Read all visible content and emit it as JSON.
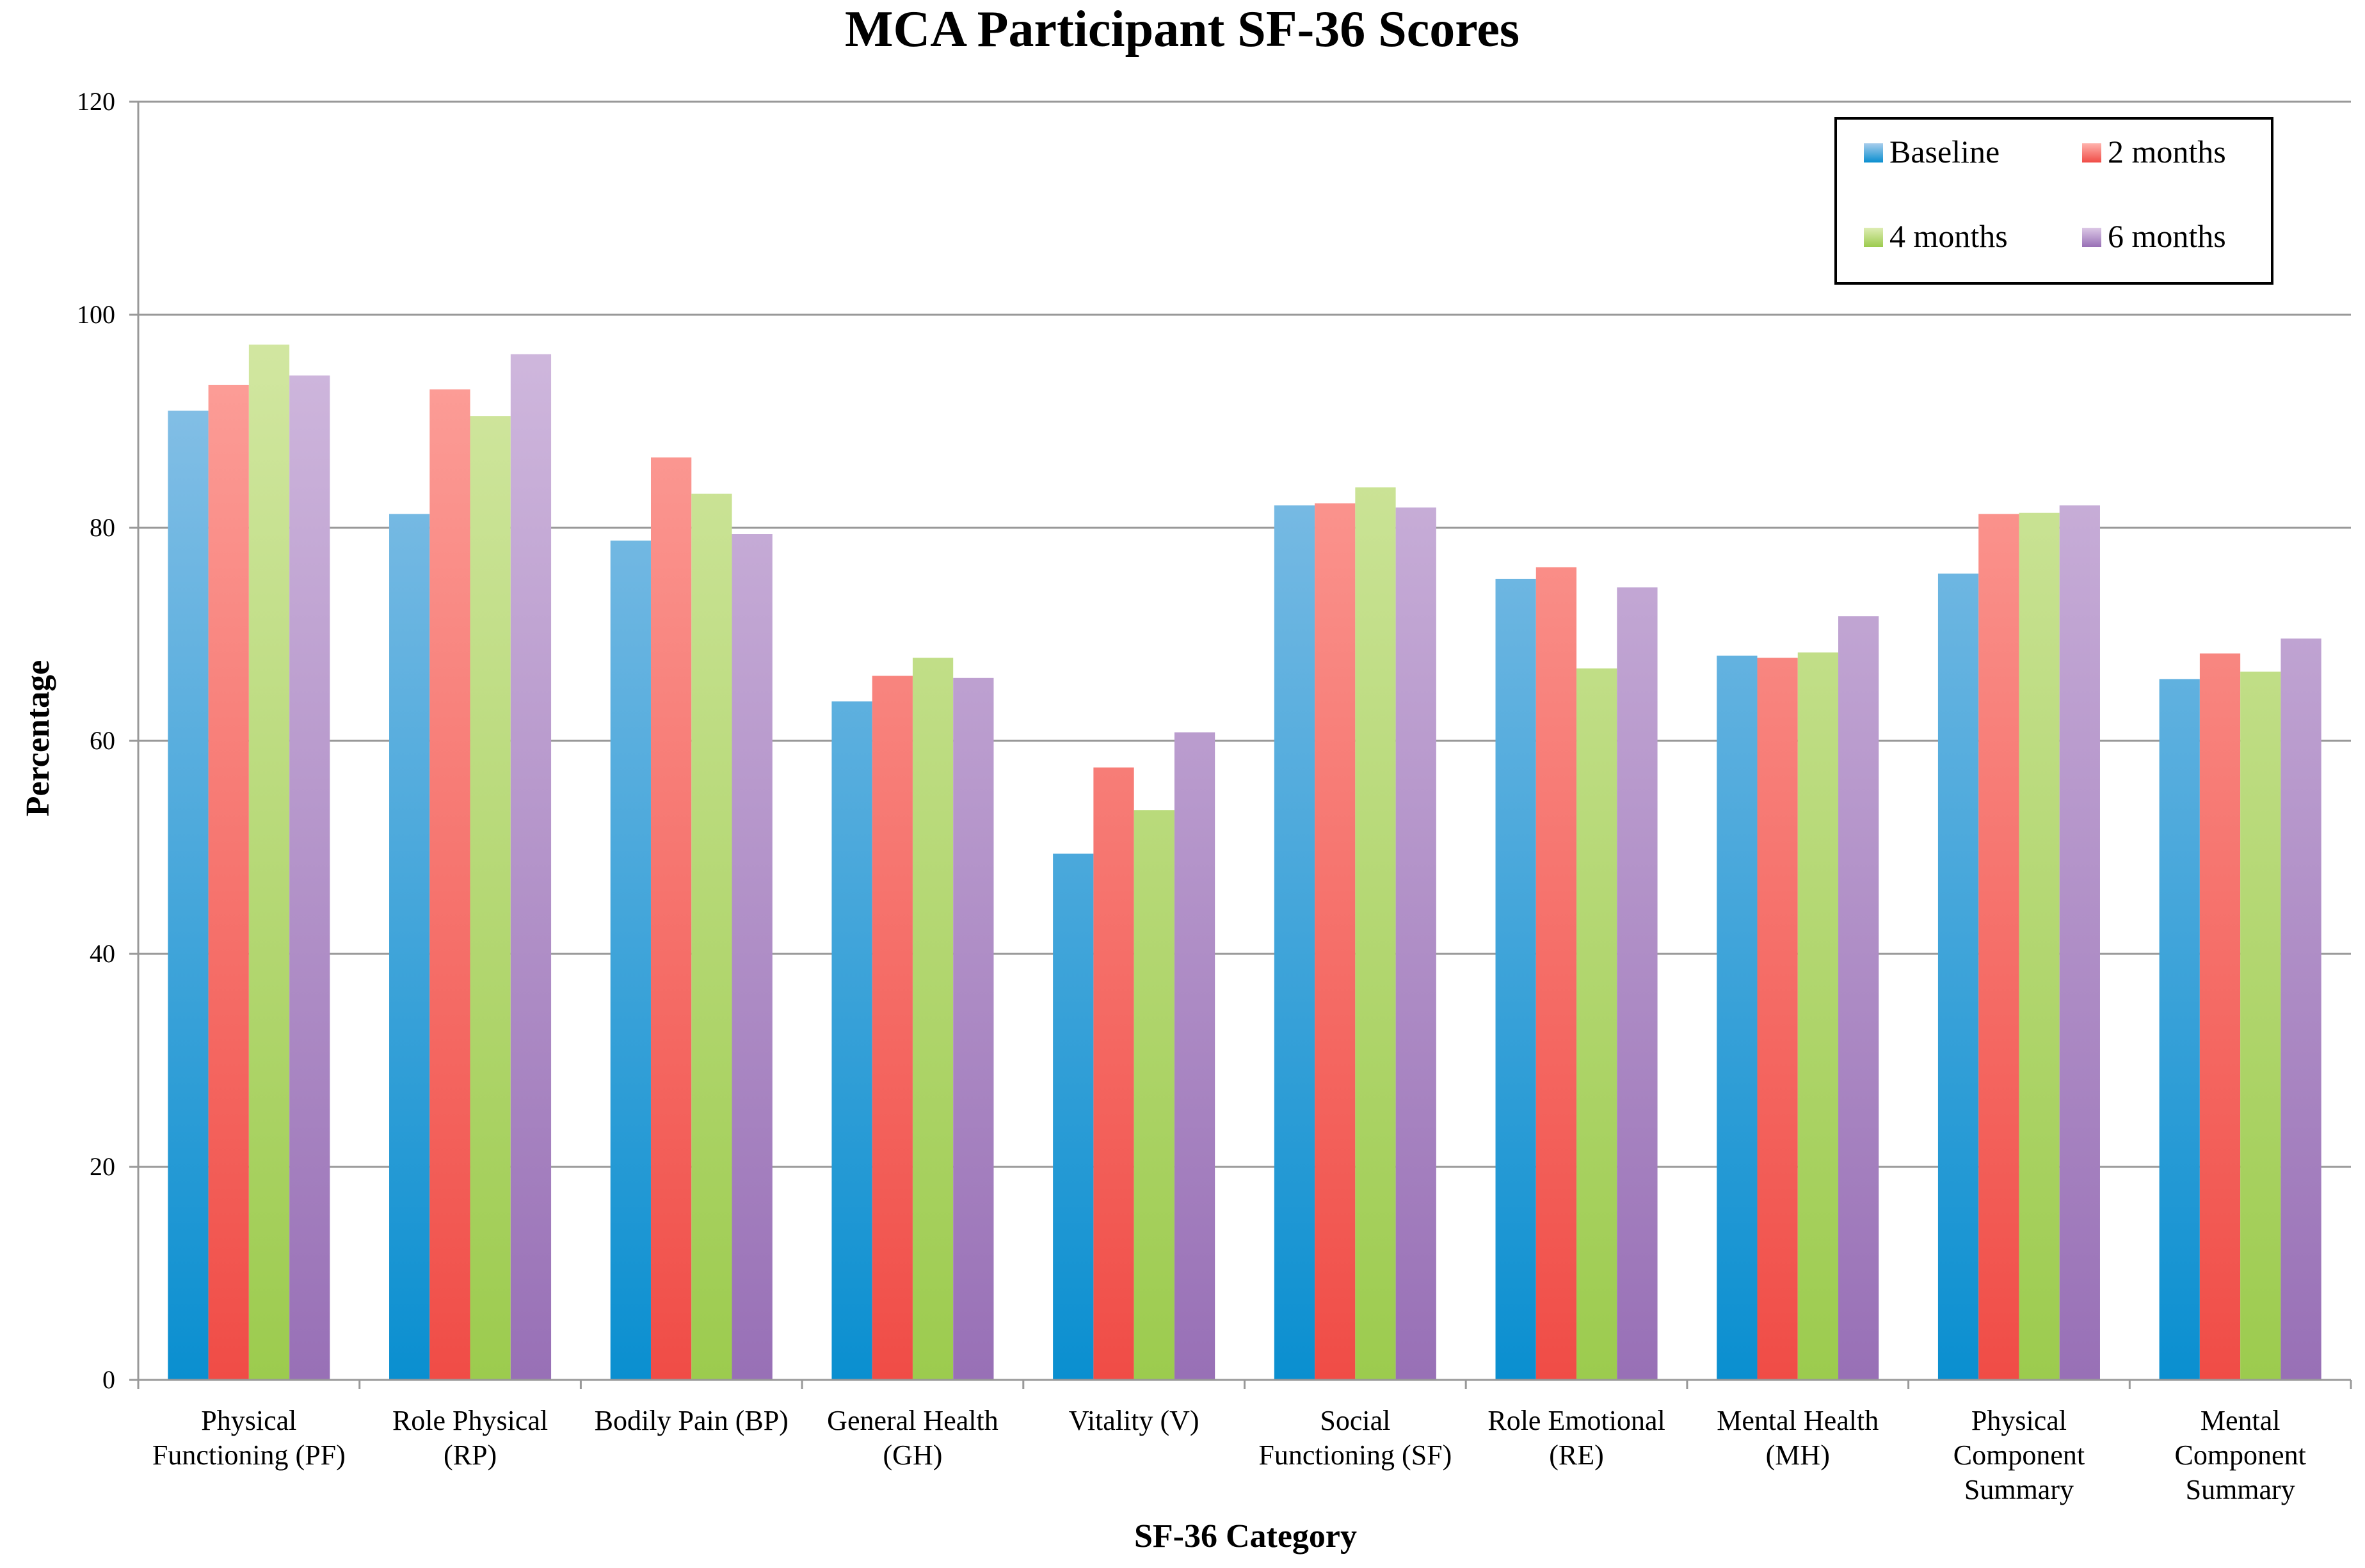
{
  "chart_data": {
    "type": "bar",
    "title": "MCA Participant SF-36 Scores",
    "xlabel": "SF-36 Category",
    "ylabel": "Percentage",
    "ylim": [
      0,
      120
    ],
    "yticks": [
      "0",
      "20",
      "40",
      "60",
      "80",
      "100",
      "120"
    ],
    "grid": true,
    "legend_position": "top-right",
    "categories": [
      [
        "Physical",
        "Functioning (PF)"
      ],
      [
        "Role Physical",
        "(RP)"
      ],
      [
        "Bodily Pain (BP)"
      ],
      [
        "General Health",
        "(GH)"
      ],
      [
        "Vitality (V)"
      ],
      [
        "Social",
        "Functioning (SF)"
      ],
      [
        "Role Emotional",
        "(RE)"
      ],
      [
        "Mental Health",
        "(MH)"
      ],
      [
        "Physical",
        "Component",
        "Summary"
      ],
      [
        "Mental",
        "Component",
        "Summary"
      ]
    ],
    "series": [
      {
        "name": "Baseline",
        "color": "#3f9fdc",
        "values": [
          91.0,
          81.3,
          78.8,
          63.7,
          49.4,
          82.1,
          75.2,
          68.0,
          75.7,
          65.8
        ]
      },
      {
        "name": "2 months",
        "color": "#f6635c",
        "values": [
          93.4,
          93.0,
          86.6,
          66.1,
          57.5,
          82.3,
          76.3,
          67.8,
          81.3,
          68.2
        ]
      },
      {
        "name": "4 months",
        "color": "#b0d86c",
        "values": [
          97.2,
          90.5,
          83.2,
          67.8,
          53.5,
          83.8,
          66.8,
          68.3,
          81.4,
          66.5
        ]
      },
      {
        "name": "6 months",
        "color": "#ad8cc6",
        "values": [
          94.3,
          96.3,
          79.4,
          65.9,
          60.8,
          81.9,
          74.4,
          71.7,
          82.1,
          69.6
        ]
      }
    ]
  }
}
